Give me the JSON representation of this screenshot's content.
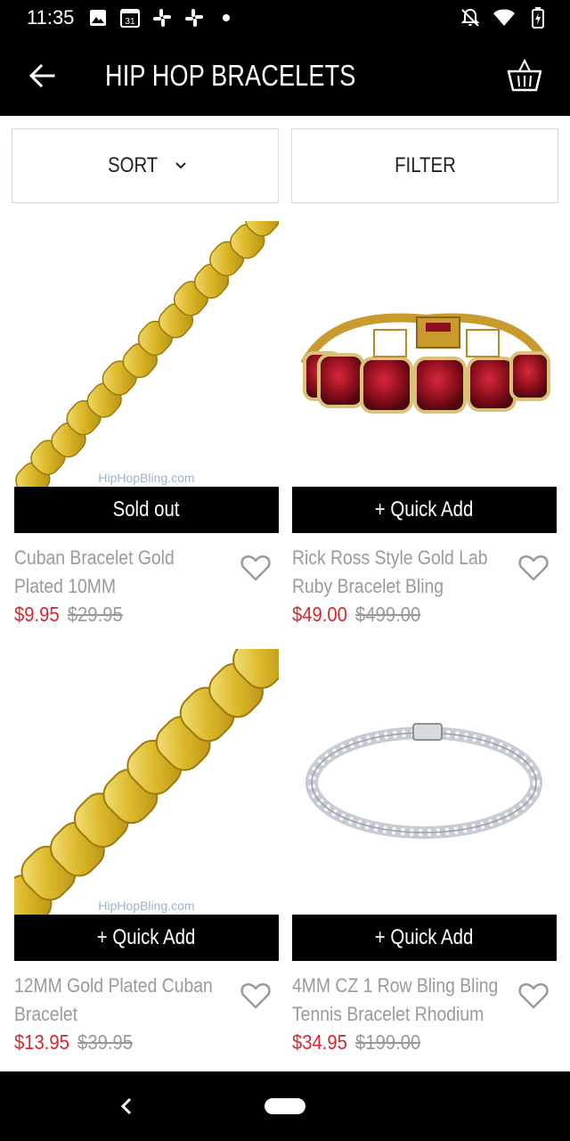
{
  "status_bar": {
    "time": "11:35",
    "calendar_day": "31"
  },
  "app_bar": {
    "title": "HIP HOP BRACELETS"
  },
  "toolbar": {
    "sort_label": "SORT",
    "filter_label": "FILTER"
  },
  "products": [
    {
      "name": "Cuban Bracelet Gold Plated 10MM",
      "button": "Sold out",
      "price": "$9.95",
      "old_price": "$29.95",
      "watermark": "HipHopBling.com"
    },
    {
      "name": "Rick Ross Style Gold Lab Ruby Bracelet Bling",
      "button": "+ Quick Add",
      "price": "$49.00",
      "old_price": "$499.00",
      "watermark": ""
    },
    {
      "name": "12MM Gold Plated Cuban Bracelet",
      "button": "+ Quick Add",
      "price": "$13.95",
      "old_price": "$39.95",
      "watermark": "HipHopBling.com"
    },
    {
      "name": "4MM CZ 1 Row Bling Bling Tennis Bracelet Rhodium",
      "button": "+ Quick Add",
      "price": "$34.95",
      "old_price": "$199.00",
      "watermark": ""
    }
  ],
  "colors": {
    "sale_price": "#d8262c",
    "muted_text": "#9a9a9a",
    "bar_background": "#000000"
  },
  "icons": {
    "back": "arrow-left-icon",
    "cart": "basket-icon",
    "sort_chevron": "chevron-down-icon",
    "favorite": "heart-outline-icon"
  }
}
